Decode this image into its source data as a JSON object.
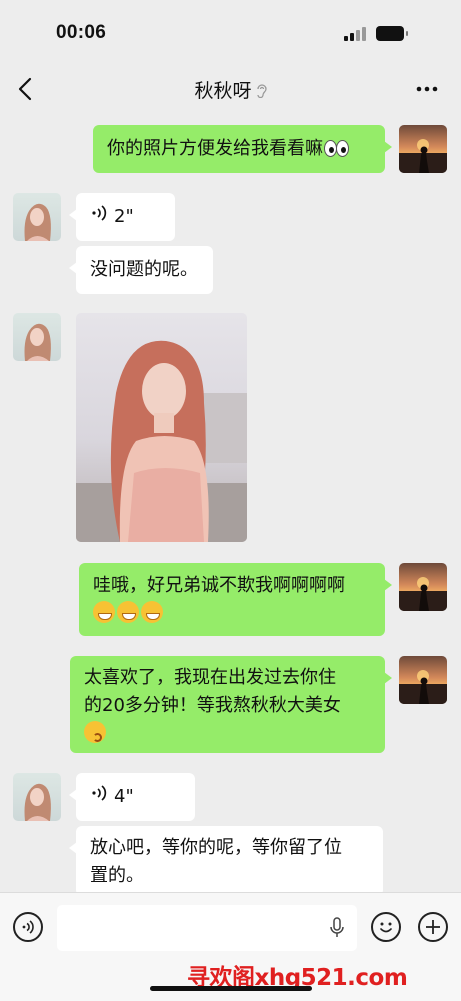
{
  "status": {
    "time": "00:06"
  },
  "header": {
    "title": "秋秋呀"
  },
  "messages": {
    "m1": {
      "text": "你的照片方便发给我看看嘛"
    },
    "m2": {
      "duration": "2\""
    },
    "m3": {
      "text": "没问题的呢。"
    },
    "m5": {
      "text": "哇哦，好兄弟诚不欺我啊啊啊啊"
    },
    "m6": {
      "line1": "太喜欢了，我现在出发过去你住",
      "line2": "的20多分钟！等我熬秋秋大美女"
    },
    "m7": {
      "duration": "4\""
    },
    "m8": {
      "line1": "放心吧，等你的呢，等你留了位",
      "line2": "置的。"
    }
  },
  "watermark": {
    "text": "寻欢阁xhg521.com"
  },
  "icons": {
    "back": "back-arrow-icon",
    "ear": "ear-icon",
    "more": "more-dots-icon",
    "voice": "voice-wave-icon",
    "mic": "microphone-icon",
    "emoji": "emoji-icon",
    "add": "plus-icon"
  },
  "colors": {
    "outgoing_bubble": "#95ec69",
    "incoming_bubble": "#ffffff",
    "background": "#ededed",
    "watermark": "#e02020"
  }
}
